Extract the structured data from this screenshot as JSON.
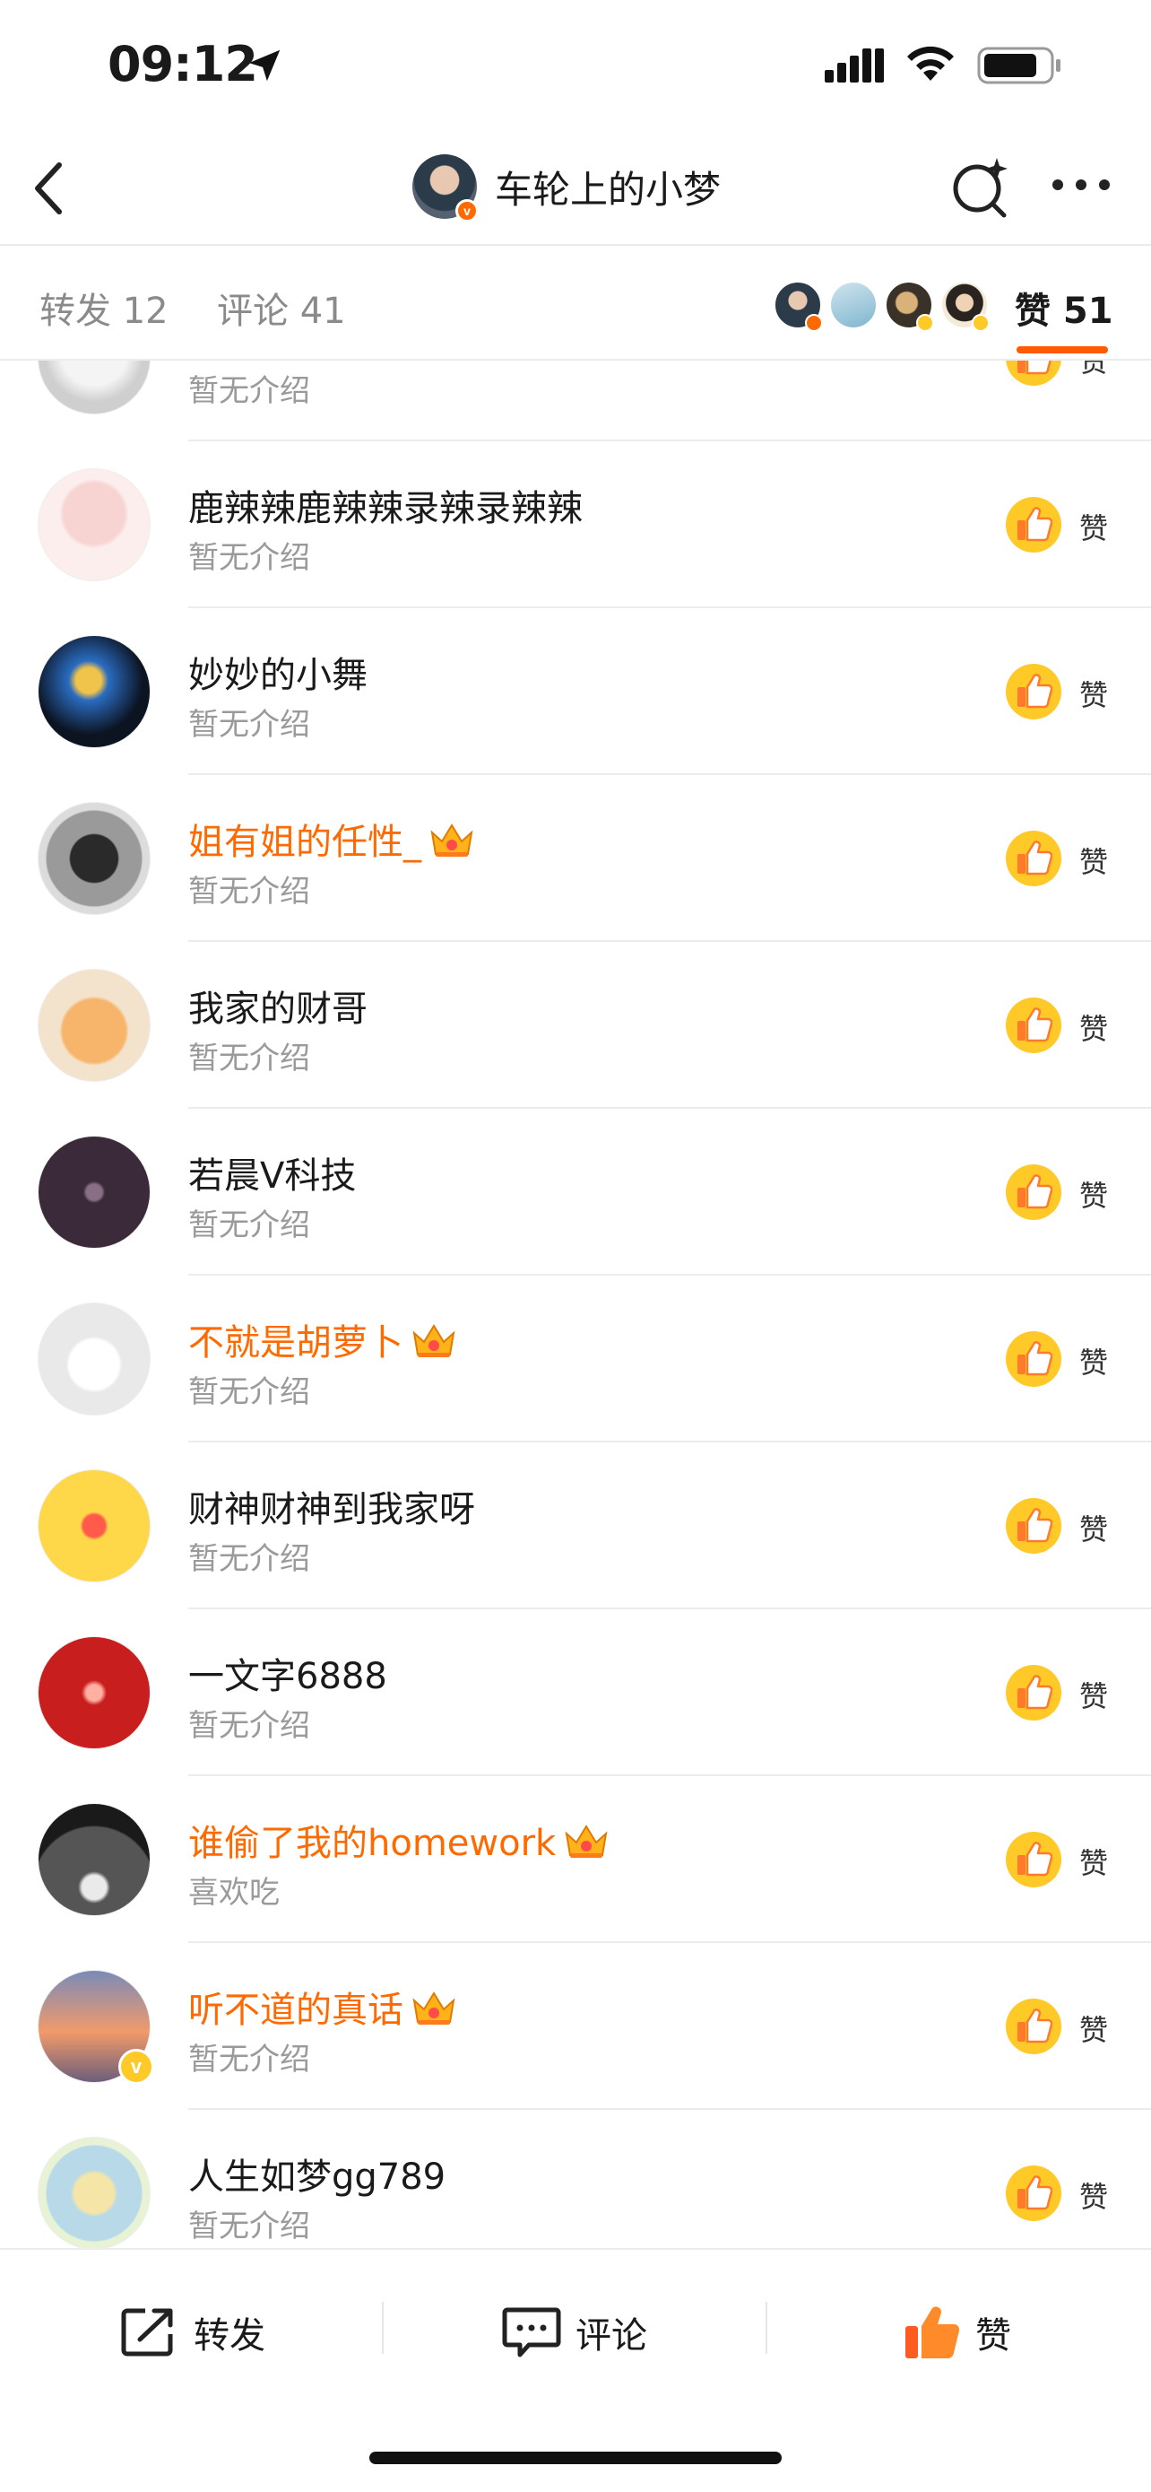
{
  "status_bar": {
    "time": "09:12"
  },
  "header": {
    "title": "车轮上的小梦"
  },
  "tabs": {
    "forward_label": "转发 12",
    "comment_label": "评论 41",
    "like_label": "赞 51",
    "active": "like"
  },
  "colors": {
    "accent": "#ff6a00",
    "like_yellow": "#ffc928",
    "vip_name": "#ff6a00",
    "muted": "#9a9a9a"
  },
  "likes_list": [
    {
      "name": "",
      "desc": "暂无介绍",
      "vip": false,
      "like_label": "赞"
    },
    {
      "name": "鹿辣辣鹿辣辣录辣录辣辣",
      "desc": "暂无介绍",
      "vip": false,
      "like_label": "赞"
    },
    {
      "name": "妙妙的小舞",
      "desc": "暂无介绍",
      "vip": false,
      "like_label": "赞"
    },
    {
      "name": "姐有姐的任性_",
      "desc": "暂无介绍",
      "vip": true,
      "like_label": "赞"
    },
    {
      "name": "我家的财哥",
      "desc": "暂无介绍",
      "vip": false,
      "like_label": "赞"
    },
    {
      "name": "若晨Ⅴ科技",
      "desc": "暂无介绍",
      "vip": false,
      "like_label": "赞"
    },
    {
      "name": "不就是胡萝卜",
      "desc": "暂无介绍",
      "vip": true,
      "like_label": "赞"
    },
    {
      "name": "财神财神到我家呀",
      "desc": "暂无介绍",
      "vip": false,
      "like_label": "赞"
    },
    {
      "name": "一文字6888",
      "desc": "暂无介绍",
      "vip": false,
      "like_label": "赞"
    },
    {
      "name": "谁偷了我的homework",
      "desc": "喜欢吃",
      "vip": true,
      "like_label": "赞"
    },
    {
      "name": "听不道的真话",
      "desc": "暂无介绍",
      "vip": true,
      "like_label": "赞"
    },
    {
      "name": "人生如梦gg789",
      "desc": "暂无介绍",
      "vip": false,
      "like_label": "赞"
    }
  ],
  "bottom_bar": {
    "forward": "转发",
    "comment": "评论",
    "like": "赞"
  }
}
